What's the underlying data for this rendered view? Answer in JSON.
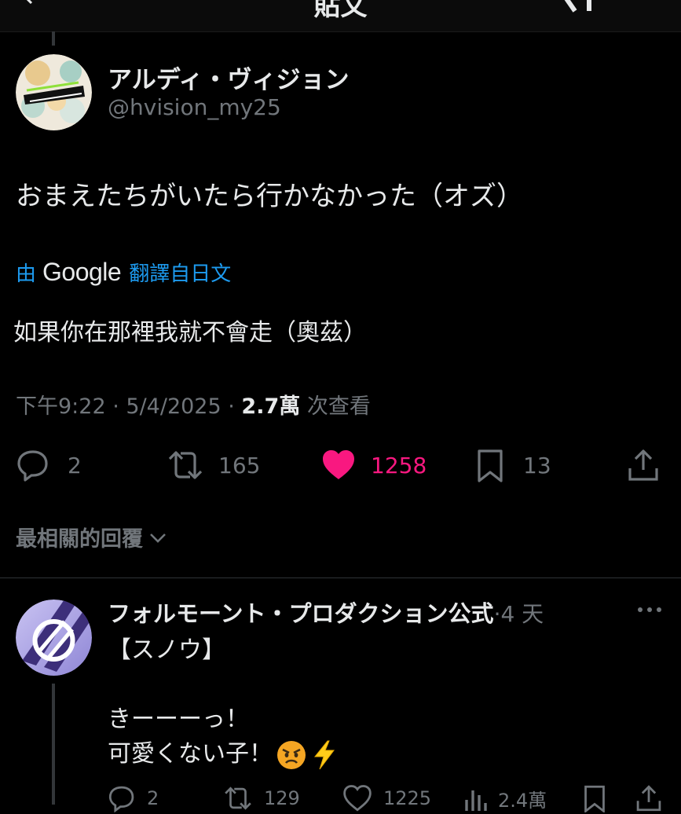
{
  "header": {
    "title": "貼文"
  },
  "post": {
    "display_name": "アルディ・ヴィジョン",
    "handle": "@hvision_my25",
    "avatar_text": "HARD VISION",
    "text": "おまえたちがいたら行かなかった（オズ）",
    "translation": {
      "prefix": "由",
      "service": "Google",
      "suffix": "翻譯自日文",
      "text": "如果你在那裡我就不會走（奧茲）"
    },
    "meta": {
      "time": "下午9:22",
      "date": "5/4/2025",
      "separator": " · ",
      "views": "2.7萬",
      "views_suffix": "次查看"
    },
    "actions": {
      "replies": "2",
      "reposts": "165",
      "likes": "1258",
      "bookmarks": "13",
      "liked_color": "#f91880"
    }
  },
  "replies_sort": {
    "label": "最相關的回覆"
  },
  "reply": {
    "display_name": "フォルモーント・プロダクション公式",
    "time": "·4 天",
    "lines": [
      "【スノウ】",
      "",
      "きーーーっ！",
      "可愛くない子！"
    ],
    "actions": {
      "replies": "2",
      "reposts": "129",
      "likes": "1225",
      "views": "2.4萬"
    }
  },
  "icons": {
    "back": "chevron-left-icon",
    "grok": "grok-icon",
    "reply": "reply-icon",
    "repost": "repost-icon",
    "like": "heart-icon",
    "bookmark": "bookmark-icon",
    "share": "share-icon",
    "more": "more-icon",
    "views": "views-icon"
  },
  "colors": {
    "accent": "#1d9bf0",
    "like": "#f91880",
    "muted": "#71767b",
    "text": "#e7e9ea",
    "background": "#000000"
  }
}
